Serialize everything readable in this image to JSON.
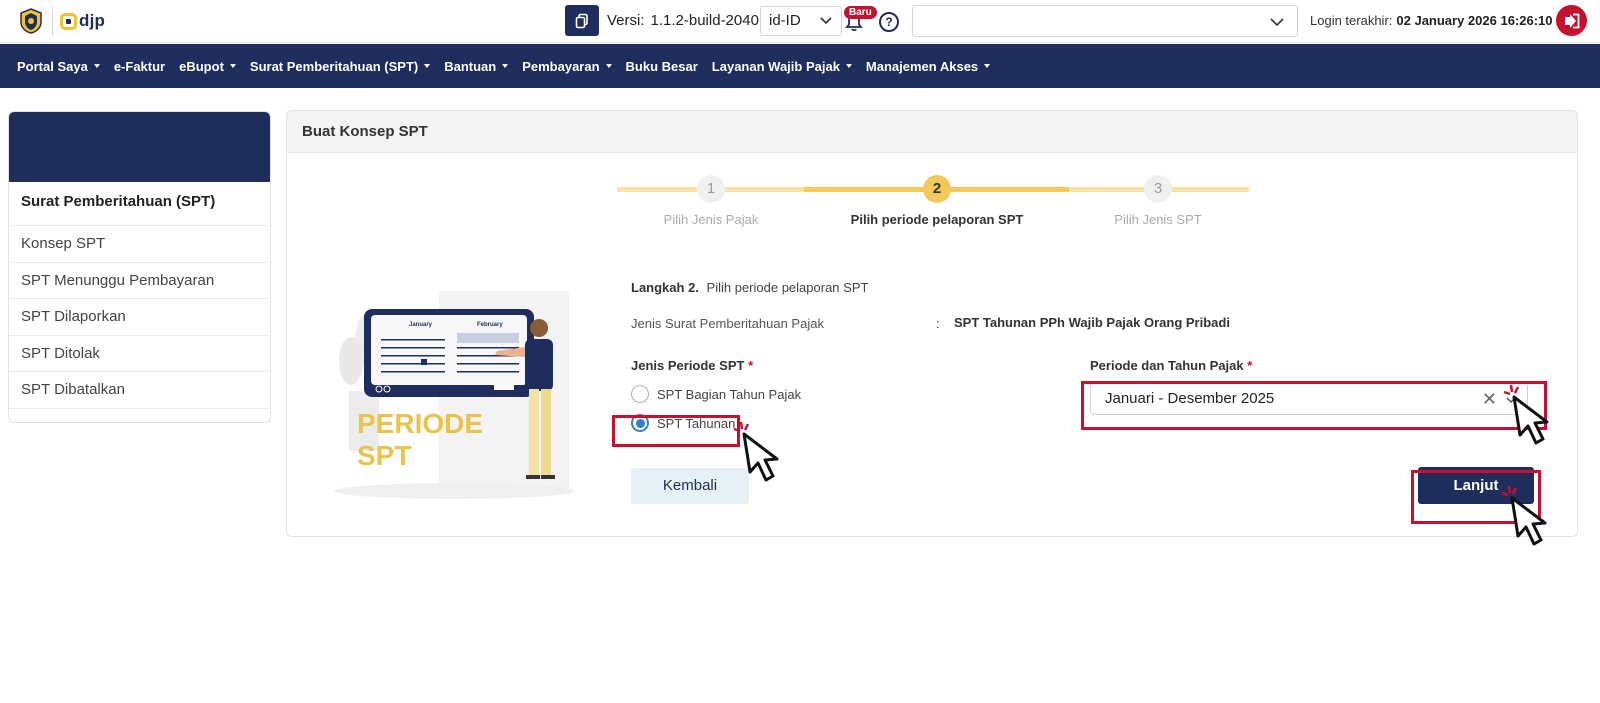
{
  "topbar": {
    "logo_text": "djp",
    "version_label": "Versi:",
    "version_value": "1.1.2-build-2040",
    "language": "id-ID",
    "notification_badge": "Baru",
    "help_symbol": "?",
    "search_value": "",
    "login_label": "Login terakhir:",
    "login_value": "02 January 2026 16:26:10"
  },
  "nav": {
    "items": [
      {
        "label": "Portal Saya",
        "dropdown": true
      },
      {
        "label": "e-Faktur",
        "dropdown": false
      },
      {
        "label": "eBupot",
        "dropdown": true
      },
      {
        "label": "Surat Pemberitahuan (SPT)",
        "dropdown": true
      },
      {
        "label": "Bantuan",
        "dropdown": true
      },
      {
        "label": "Pembayaran",
        "dropdown": true
      },
      {
        "label": "Buku Besar",
        "dropdown": false
      },
      {
        "label": "Layanan Wajib Pajak",
        "dropdown": true
      },
      {
        "label": "Manajemen Akses",
        "dropdown": true
      }
    ]
  },
  "sidebar": {
    "title": "Surat Pemberitahuan (SPT)",
    "items": [
      {
        "label": "Konsep SPT"
      },
      {
        "label": "SPT Menunggu Pembayaran"
      },
      {
        "label": "SPT Dilaporkan"
      },
      {
        "label": "SPT Ditolak"
      },
      {
        "label": "SPT Dibatalkan"
      }
    ]
  },
  "card": {
    "title": "Buat Konsep SPT"
  },
  "stepper": {
    "steps": [
      {
        "number": "1",
        "label": "Pilih Jenis Pajak",
        "state": "done"
      },
      {
        "number": "2",
        "label": "Pilih periode pelaporan SPT",
        "state": "active"
      },
      {
        "number": "3",
        "label": "Pilih Jenis SPT",
        "state": "pending"
      }
    ]
  },
  "illustration": {
    "month_left": "January",
    "month_right": "February",
    "text_line1": "PERIODE",
    "text_line2": "SPT"
  },
  "form": {
    "langkah_bold": "Langkah 2.",
    "langkah_text": "Pilih periode pelaporan SPT",
    "jenis_label": "Jenis Surat Pemberitahuan Pajak",
    "jenis_colon": ":",
    "jenis_value": "SPT Tahunan PPh Wajib Pajak Orang Pribadi",
    "periode_title": "Jenis Periode SPT",
    "required_mark": "*",
    "radio_options": [
      {
        "label": "SPT Bagian Tahun Pajak",
        "checked": false
      },
      {
        "label": "SPT Tahunan",
        "checked": true
      }
    ],
    "tahun_title": "Periode dan Tahun Pajak",
    "tahun_value": "Januari - Desember 2025",
    "back_label": "Kembali",
    "next_label": "Lanjut"
  },
  "colors": {
    "primary": "#1f2d5c",
    "accent": "#f2c233",
    "highlight": "#c8102e"
  }
}
